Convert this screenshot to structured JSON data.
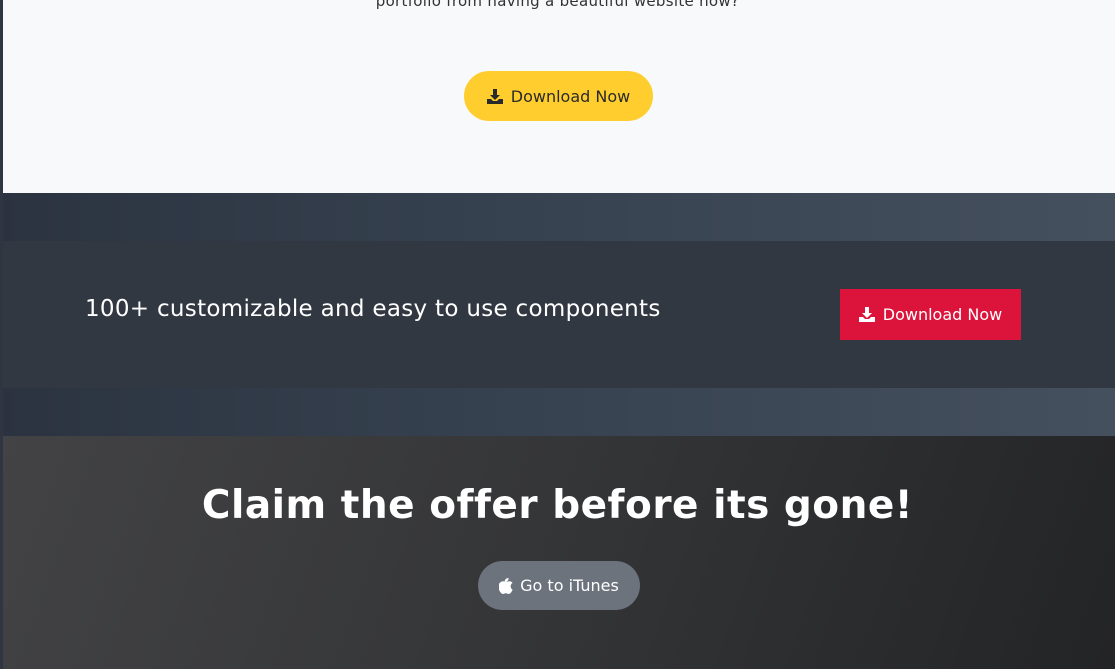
{
  "hero": {
    "text_fragment": "portfolio from having a beautiful website now?",
    "download_button": {
      "label": "Download Now",
      "icon": "download-icon"
    }
  },
  "promo": {
    "text": "100+ customizable and easy to use components",
    "download_button": {
      "label": "Download Now",
      "icon": "download-icon"
    }
  },
  "offer": {
    "title": "Claim the offer before its gone!",
    "itunes_button": {
      "label": "Go to iTunes",
      "icon": "apple-icon"
    }
  },
  "colors": {
    "yellow_button": "#ffce2e",
    "red_button": "#dc143c",
    "grey_button": "#6c737d",
    "light_background": "#f8f9fa",
    "dark_band": "#323842"
  }
}
